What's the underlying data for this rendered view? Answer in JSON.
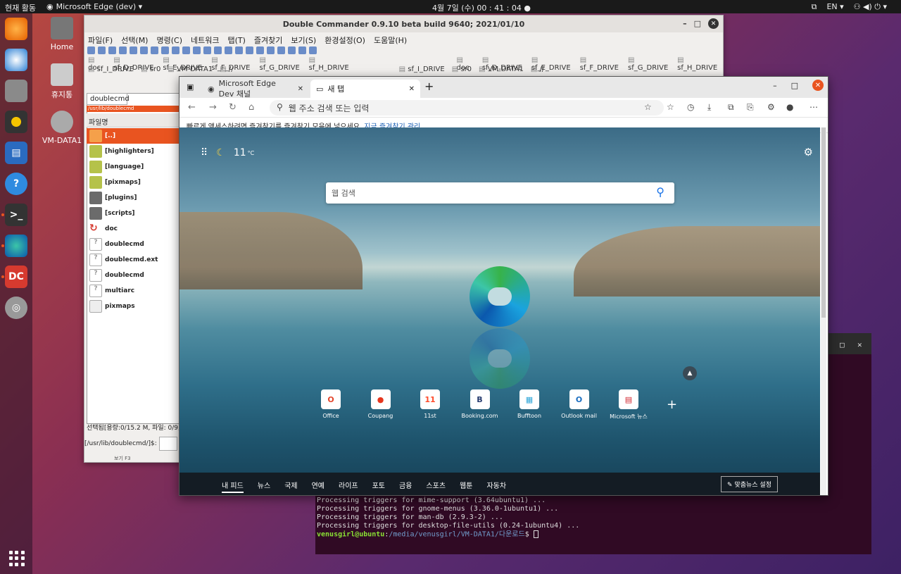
{
  "topbar": {
    "activities": "현재 활동",
    "app": "Microsoft Edge (dev) ▾",
    "clock": "4월 7일 (수)  00 : 41 : 04  ●",
    "lang": "EN ▾",
    "sys": "⚇  ◀)  ⏻ ▾"
  },
  "desktop": {
    "home": "Home",
    "trash": "휴지통",
    "vm": "VM-DATA1"
  },
  "dc": {
    "title": "Double Commander 0.9.10 beta build 9640; 2021/01/10",
    "menu": [
      "파일(F)",
      "선택(M)",
      "명령(C)",
      "네트워크",
      "탭(T)",
      "즐겨찾기",
      "보기(S)",
      "환경설정(O)",
      "도움말(H)"
    ],
    "drives": [
      "doc",
      "sf_D_DRIVE",
      "sf_E_DRIVE",
      "sf_F_DRIVE",
      "sf_G_DRIVE",
      "sf_H_DRIVE"
    ],
    "drives2": [
      "sf_I_DRIVE",
      "sr0",
      "VM-DATA1",
      "//"
    ],
    "tab": "doublecmd",
    "path": "/usr/lib/doublecmd",
    "col": "파일명",
    "files": [
      "[..]",
      "[highlighters]",
      "[language]",
      "[pixmaps]",
      "[plugins]",
      "[scripts]",
      "doc",
      "doublecmd",
      "doublecmd.ext",
      "doublecmd",
      "multiarc",
      "pixmaps"
    ],
    "status": "선택됨[용량:0/15.2 M, 파일: 0/9,",
    "cmd": "[/usr/lib/doublecmd/]$:",
    "f3": "보기 F3"
  },
  "terminal": {
    "lines": [
      "Processing triggers for mime-support (3.64ubuntu1) ...",
      "Processing triggers for gnome-menus (3.36.0-1ubuntu1) ...",
      "Processing triggers for man-db (2.9.3-2) ...",
      "Processing triggers for desktop-file-utils (0.24-1ubuntu4) ..."
    ],
    "user": "venusgirl@ubuntu",
    "path": "/media/venusgirl/VM-DATA1/다운로드",
    "sym": "$"
  },
  "edge": {
    "tab1": "Microsoft Edge Dev 채널",
    "tab2": "새 탭",
    "url_placeholder": "웹 주소 검색 또는 입력",
    "favbar": "빠르게 액세스하려면 즐겨찾기를 즐겨찾기 모음에 넣으세요.",
    "favlink": "지금 즐겨찾기 관리",
    "weather": "11",
    "unit": "°C",
    "search_placeholder": "웹 검색",
    "tiles": [
      {
        "label": "Office",
        "glyph": "O",
        "color": "#e3452b"
      },
      {
        "label": "Coupang",
        "glyph": "●",
        "color": "#e6361e"
      },
      {
        "label": "11st",
        "glyph": "11",
        "color": "#ff4b2b"
      },
      {
        "label": "Booking.com",
        "glyph": "B",
        "color": "#263b6e"
      },
      {
        "label": "Bufftoon",
        "glyph": "▦",
        "color": "#2fa6d8"
      },
      {
        "label": "Outlook mail",
        "glyph": "O",
        "color": "#1a6ec0"
      },
      {
        "label": "Microsoft 뉴스",
        "glyph": "▤",
        "color": "#d0242d"
      }
    ],
    "feed": [
      "내 피드",
      "뉴스",
      "국제",
      "연예",
      "라이프",
      "포토",
      "금융",
      "스포츠",
      "웹툰",
      "자동차"
    ],
    "feedset": "✎ 맞춤뉴스 설정"
  }
}
